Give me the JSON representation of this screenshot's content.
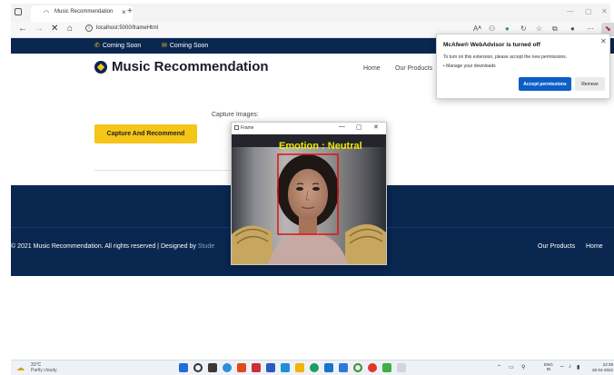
{
  "browser": {
    "tab_title": "Music Recommendation",
    "url": "localhost:5000/frameHtml",
    "read_aloud_label": "Aᴬ"
  },
  "site": {
    "top_items": [
      "Coming Soon",
      "Coming Soon"
    ],
    "title": "Music Recommendation",
    "menu": [
      "Home",
      "Our Products"
    ],
    "capture_label": "Capture Images:",
    "capture_button": "Capture And Recommend",
    "footer_copy": "© 2021 Music Recommendation. All rights reserved | Designed by",
    "footer_designer": "Stude",
    "footer_links": [
      "Our Products",
      "Home"
    ]
  },
  "frame_window": {
    "title": "Frame",
    "emotion_label": "Emotion : Neutral",
    "face_box_color": "#e01010"
  },
  "mcafee_popup": {
    "title": "McAfee® WebAdvisor is turned off",
    "message": "To turn on this extension, please accept the new permissions.",
    "link": "• Manage your downloads",
    "accept_label": "Accept permissions",
    "remove_label": "Remove"
  },
  "taskbar": {
    "temperature": "31°C",
    "condition": "Partly cloudy",
    "language_line1": "ENG",
    "language_line2": "IN",
    "time": "22:39",
    "date": "26-04-2022"
  },
  "colors": {
    "navy": "#0a2750",
    "accent_yellow": "#f5c518",
    "popup_blue": "#0b5fc5"
  }
}
